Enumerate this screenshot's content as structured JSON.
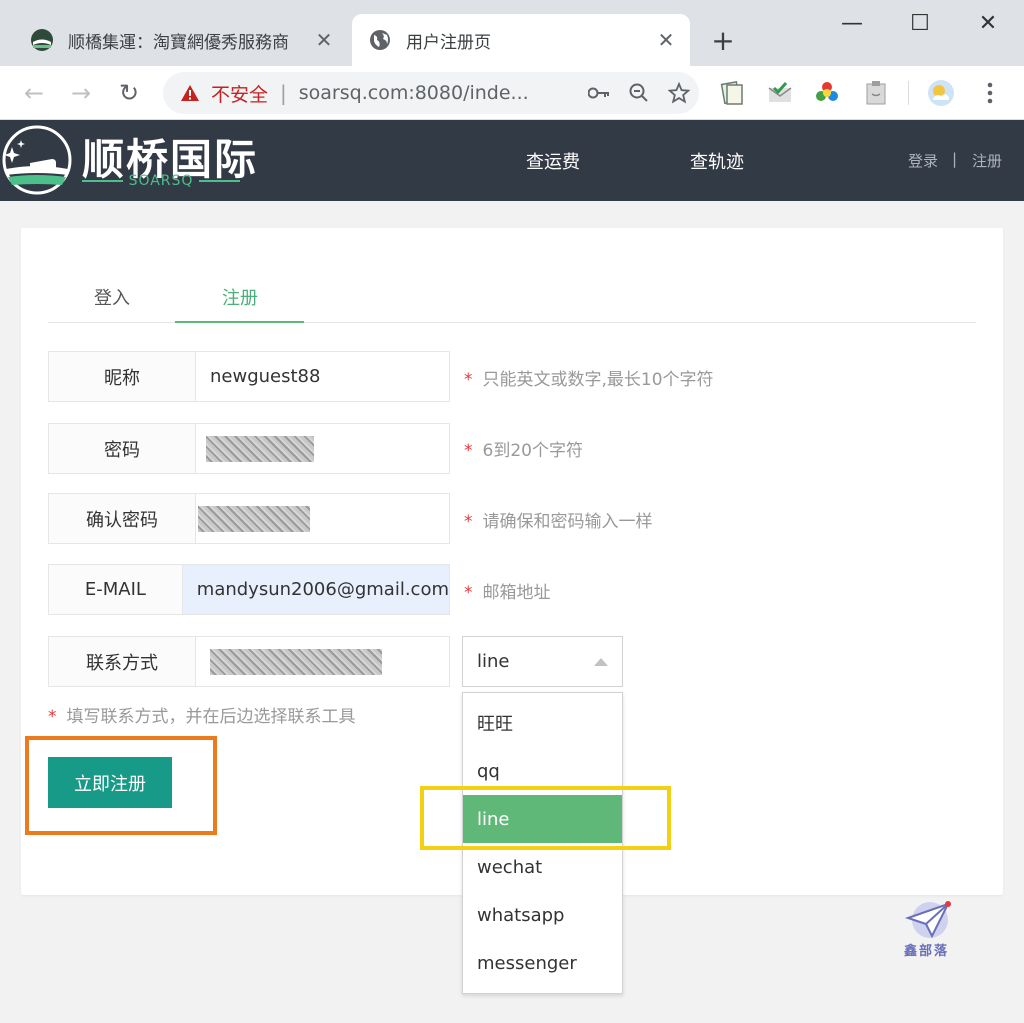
{
  "browser": {
    "tabs": [
      {
        "title": "顺橋集運：淘寶網優秀服務商",
        "close": "✕"
      },
      {
        "title": "用户注册页",
        "close": "✕"
      }
    ],
    "new_tab": "+",
    "window_controls": {
      "minimize": "—",
      "maximize": "☐",
      "close": "✕"
    },
    "nav": {
      "back": "←",
      "forward": "→",
      "reload": "↻"
    },
    "omnibox": {
      "security_label": "不安全",
      "url": "soarsq.com:8080/inde..."
    }
  },
  "site": {
    "brand": "顺桥国际",
    "brand_sub": "SOARSQ",
    "nav": {
      "rate": "查运费",
      "track": "查轨迹"
    },
    "auth": {
      "login": "登录",
      "divider": "|",
      "register": "注册"
    }
  },
  "form": {
    "tabs": {
      "login": "登入",
      "register": "注册"
    },
    "fields": {
      "nickname": {
        "label": "昵称",
        "value": "newguest88",
        "hint": "只能英文或数字,最长10个字符"
      },
      "password": {
        "label": "密码",
        "hint": "6到20个字符"
      },
      "confirm": {
        "label": "确认密码",
        "hint": "请确保和密码输入一样"
      },
      "email": {
        "label": "E-MAIL",
        "value": "mandysun2006@gmail.com",
        "hint": "邮箱地址"
      },
      "contact": {
        "label": "联系方式",
        "select_value": "line"
      }
    },
    "required_mark": "*",
    "contact_hint": "填写联系方式，并在后边选择联系工具",
    "submit": "立即注册",
    "contact_options": [
      "旺旺",
      "qq",
      "line",
      "wechat",
      "whatsapp",
      "messenger"
    ],
    "selected_option": "line"
  },
  "watermark": {
    "text": "鑫部落"
  },
  "colors": {
    "header": "#323a45",
    "accent": "#5fb878",
    "submit": "#179b88",
    "highlight_orange": "#ec7b20",
    "highlight_yellow": "#f3d011"
  }
}
